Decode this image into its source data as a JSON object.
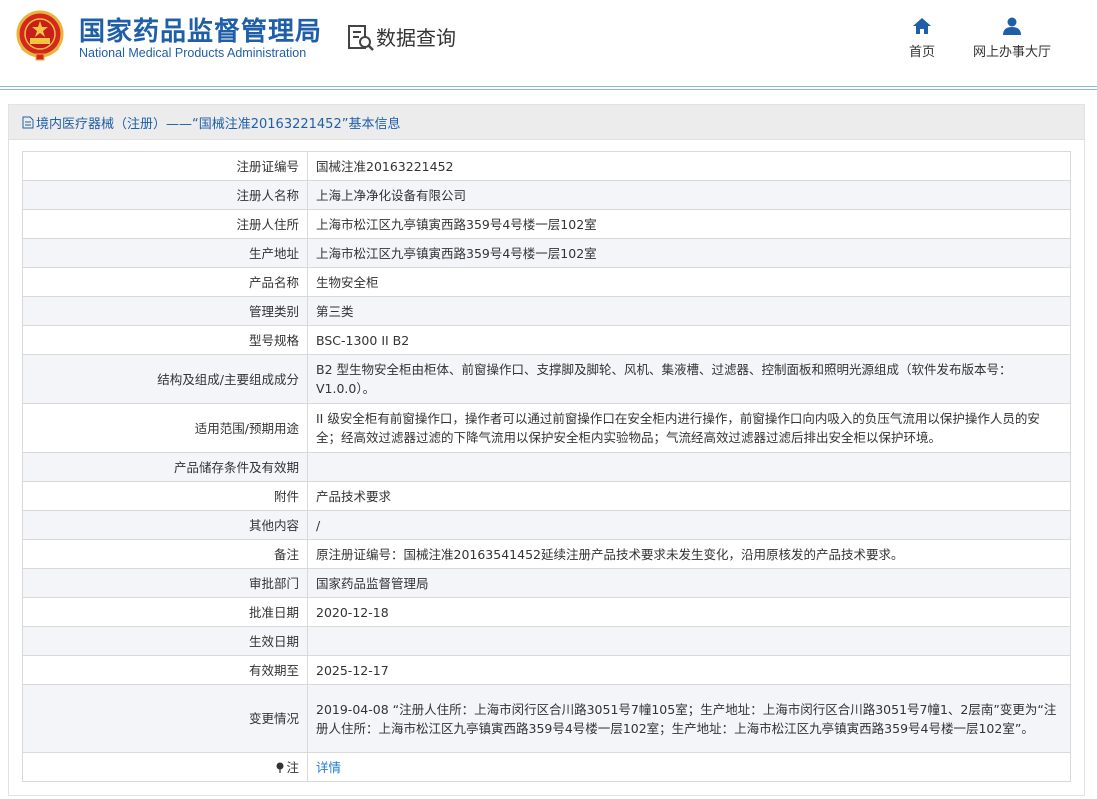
{
  "header": {
    "logo_cn": "国家药品监督管理局",
    "logo_en": "National Medical Products Administration",
    "section_title": "数据查询",
    "nav": [
      {
        "label": "首页",
        "icon": "home-icon"
      },
      {
        "label": "网上办事大厅",
        "icon": "user-icon"
      }
    ]
  },
  "panel": {
    "title": "境内医疗器械（注册）——“国械注准20163221452”基本信息"
  },
  "rows": [
    {
      "label": "注册证编号",
      "value": "国械注准20163221452"
    },
    {
      "label": "注册人名称",
      "value": "上海上净净化设备有限公司"
    },
    {
      "label": "注册人住所",
      "value": "上海市松江区九亭镇寅西路359号4号楼一层102室"
    },
    {
      "label": "生产地址",
      "value": "上海市松江区九亭镇寅西路359号4号楼一层102室"
    },
    {
      "label": "产品名称",
      "value": "生物安全柜"
    },
    {
      "label": "管理类别",
      "value": "第三类"
    },
    {
      "label": "型号规格",
      "value": "BSC-1300 II B2"
    },
    {
      "label": "结构及组成/主要组成成分",
      "value": "B2 型生物安全柜由柜体、前窗操作口、支撑脚及脚轮、风机、集液槽、过滤器、控制面板和照明光源组成（软件发布版本号：V1.0.0）。"
    },
    {
      "label": "适用范围/预期用途",
      "value": "II 级安全柜有前窗操作口，操作者可以通过前窗操作口在安全柜内进行操作，前窗操作口向内吸入的负压气流用以保护操作人员的安全；经高效过滤器过滤的下降气流用以保护安全柜内实验物品；气流经高效过滤器过滤后排出安全柜以保护环境。"
    },
    {
      "label": "产品储存条件及有效期",
      "value": ""
    },
    {
      "label": "附件",
      "value": "产品技术要求"
    },
    {
      "label": "其他内容",
      "value": "/"
    },
    {
      "label": "备注",
      "value": "原注册证编号：国械注准20163541452延续注册产品技术要求未发生变化，沿用原核发的产品技术要求。"
    },
    {
      "label": "审批部门",
      "value": "国家药品监督管理局"
    },
    {
      "label": "批准日期",
      "value": "2020-12-18"
    },
    {
      "label": "生效日期",
      "value": ""
    },
    {
      "label": "有效期至",
      "value": "2025-12-17"
    },
    {
      "label": "变更情况",
      "value": "2019-04-08 “注册人住所：上海市闵行区合川路3051号7幢105室；生产地址：上海市闵行区合川路3051号7幢1、2层南”变更为“注册人住所：上海市松江区九亭镇寅西路359号4号楼一层102室；生产地址：上海市松江区九亭镇寅西路359号4号楼一层102室”。"
    }
  ],
  "note": {
    "label": "注",
    "link": "详情"
  },
  "colors": {
    "brand_blue": "#1f5fa8",
    "link_blue": "#1f7ad4",
    "header_red": "#d7261e"
  }
}
